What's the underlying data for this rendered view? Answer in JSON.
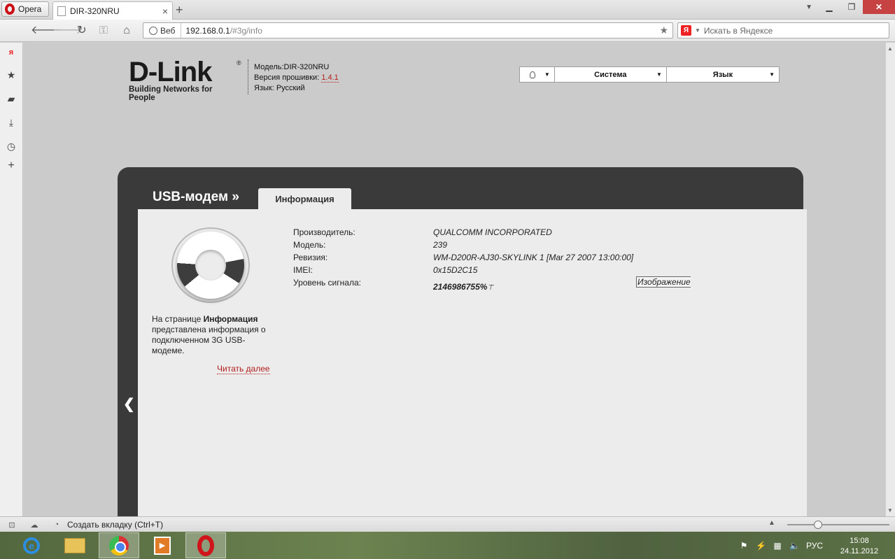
{
  "browser": {
    "menu_label": "Opera",
    "tab_title": "DIR-320NRU",
    "tab_close": "×",
    "new_tab": "+",
    "address_mode": "Веб",
    "address_host": "192.168.0.1",
    "address_path": "/#3g/info",
    "search_placeholder": "Искать в Яндексе",
    "search_engine": "Я"
  },
  "header": {
    "brand": "D-Link",
    "brand_reg": "®",
    "tagline": "Building Networks for People",
    "model_line": "Модель:DIR-320NRU",
    "firmware_label": "Версия прошивки: ",
    "firmware_version": "1.4.1",
    "language_line": "Язык: Русский"
  },
  "menu": {
    "system_label": "Система",
    "language_label": "Язык"
  },
  "panel": {
    "section_title": "USB-модем »",
    "active_tab": "Информация",
    "back_arrow": "❮",
    "description_prefix": "На странице ",
    "description_bold": "Информация",
    "description_suffix": " представлена информация о подключенном 3G USB-модеме.",
    "read_more": "Читать далее"
  },
  "info_rows": [
    {
      "label": "Производитель:",
      "value": "QUALCOMM INCORPORATED"
    },
    {
      "label": "Модель:",
      "value": "239"
    },
    {
      "label": "Ревизия:",
      "value": "WM-D200R-AJ30-SKYLINK 1 [Mar 27 2007 13:00:00]"
    },
    {
      "label": "IMEI:",
      "value": "0x15D2C15"
    },
    {
      "label": "Уровень сигнала:",
      "value": "2146986755%",
      "image_alt": "Изображение"
    }
  ],
  "statusbar": {
    "text": "Создать вкладку (Ctrl+T)"
  },
  "taskbar": {
    "language": "РУС",
    "time": "15:08",
    "date": "24.11.2012"
  },
  "colors": {
    "dark_panel": "#3a3a3a",
    "link_red": "#b21e1e",
    "opera_red": "#cc0f16"
  }
}
